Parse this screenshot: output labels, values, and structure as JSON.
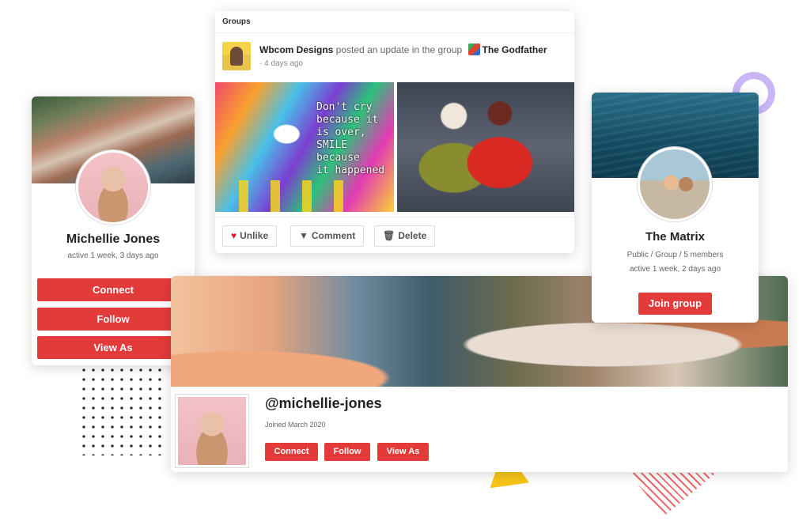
{
  "member_card": {
    "name": "Michellie Jones",
    "activity": "active 1 week, 3 days ago",
    "buttons": {
      "connect": "Connect",
      "follow": "Follow",
      "view_as": "View As"
    }
  },
  "activity_card": {
    "section_title": "Groups",
    "poster_name": "Wbcom Designs",
    "action_text": "posted an update in the group",
    "group_name": "The Godfather",
    "time": "· 4 days ago",
    "graffiti_text": [
      "Don't cry",
      "because it is over,",
      "SMILE",
      "because",
      "it happened"
    ],
    "actions": {
      "unlike": "Unlike",
      "comment": "Comment",
      "delete": "Delete"
    }
  },
  "group_card": {
    "name": "The Matrix",
    "meta": "Public / Group / 5 members",
    "activity": "active 1 week, 2 days ago",
    "join_label": "Join group"
  },
  "profile_card": {
    "handle": "@michellie-jones",
    "joined": "Joined March 2020",
    "buttons": {
      "connect": "Connect",
      "follow": "Follow",
      "view_as": "View As"
    }
  },
  "colors": {
    "accent": "#e33a3a",
    "ring": "#c9b6f7",
    "triangle": "#f7c518",
    "stripes": "#ec6a6a"
  },
  "icons": {
    "unlike": "heart-icon",
    "comment": "comment-icon",
    "delete": "trash-icon"
  }
}
